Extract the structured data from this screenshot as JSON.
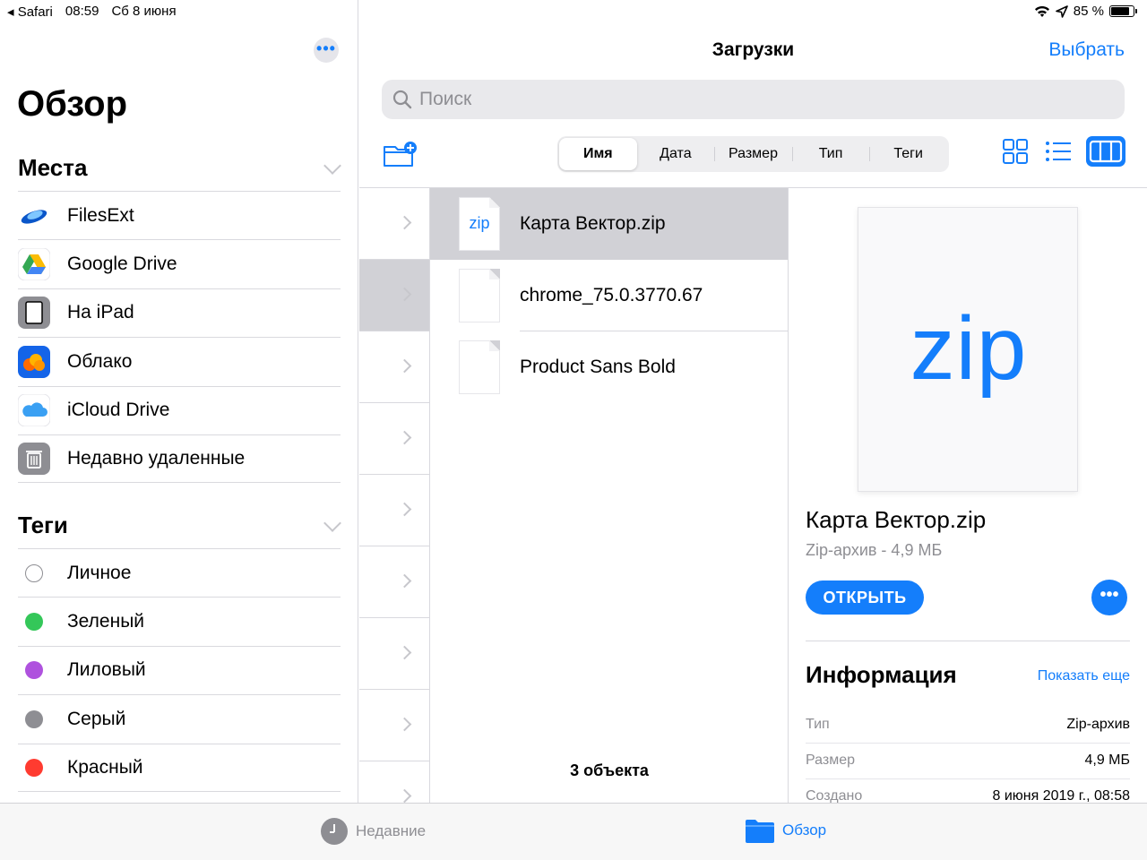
{
  "status": {
    "back_app": "Safari",
    "time": "08:59",
    "date": "Сб 8 июня",
    "battery": "85 %"
  },
  "sidebar": {
    "title": "Обзор",
    "places_header": "Места",
    "places": [
      {
        "label": "FilesExt",
        "icon": "filesext-icon"
      },
      {
        "label": "Google Drive",
        "icon": "google-drive-icon"
      },
      {
        "label": "На iPad",
        "icon": "ipad-icon"
      },
      {
        "label": "Облако",
        "icon": "cloud-app-icon"
      },
      {
        "label": "iCloud Drive",
        "icon": "icloud-icon"
      },
      {
        "label": "Недавно удаленные",
        "icon": "trash-icon"
      }
    ],
    "tags_header": "Теги",
    "tags": [
      {
        "label": "Личное",
        "color": "#ffffff"
      },
      {
        "label": "Зеленый",
        "color": "#34c759"
      },
      {
        "label": "Лиловый",
        "color": "#af52de"
      },
      {
        "label": "Серый",
        "color": "#8e8e93"
      },
      {
        "label": "Красный",
        "color": "#ff3b30"
      }
    ]
  },
  "main": {
    "title": "Загрузки",
    "select_label": "Выбрать",
    "search_placeholder": "Поиск",
    "sort_options": [
      "Имя",
      "Дата",
      "Размер",
      "Тип",
      "Теги"
    ],
    "sort_active": "Имя",
    "files": [
      {
        "name": "Карта Вектор.zip",
        "type_label": "zip",
        "selected": true
      },
      {
        "name": "chrome_75.0.3770.67",
        "type_label": "",
        "selected": false
      },
      {
        "name": "Product Sans Bold",
        "type_label": "",
        "selected": false
      }
    ],
    "count_label": "3 объекта"
  },
  "detail": {
    "preview_label": "zip",
    "name": "Карта Вектор.zip",
    "subtitle": "Zip-архив - 4,9 МБ",
    "open_label": "ОТКРЫТЬ",
    "info_title": "Информация",
    "show_more": "Показать еще",
    "info": [
      {
        "key": "Тип",
        "value": "Zip-архив"
      },
      {
        "key": "Размер",
        "value": "4,9 МБ"
      },
      {
        "key": "Создано",
        "value": "8 июня 2019 г., 08:58"
      }
    ]
  },
  "tabbar": {
    "recent_label": "Недавние",
    "browse_label": "Обзор"
  },
  "colors": {
    "accent": "#147efb",
    "selection": "#d1d1d6"
  }
}
